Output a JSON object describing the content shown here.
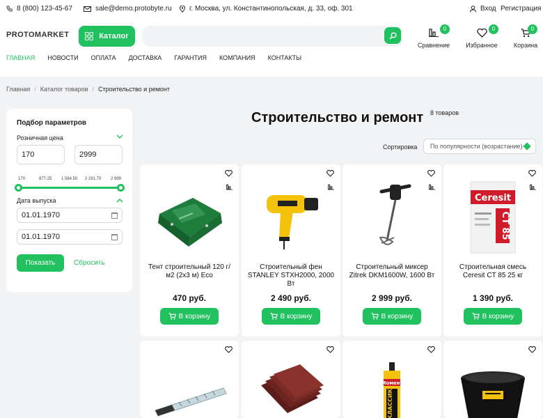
{
  "topbar": {
    "phone": "8 (800) 123-45-67",
    "email": "sale@demo.protobyte.ru",
    "address": "г. Москва, ул. Константинопольская, д. 33, оф. 301",
    "login": "Вход",
    "register": "Регистрация"
  },
  "header": {
    "logo": "PROTOMARKET",
    "catalog_label": "Каталог",
    "search_placeholder": "",
    "compare": {
      "label": "Сравнение",
      "count": "0"
    },
    "favorites": {
      "label": "Избранное",
      "count": "0"
    },
    "cart": {
      "label": "Корзина",
      "count": "0"
    }
  },
  "nav": [
    "ГЛАВНАЯ",
    "НОВОСТИ",
    "ОПЛАТА",
    "ДОСТАВКА",
    "ГАРАНТИЯ",
    "КОМПАНИЯ",
    "КОНТАКТЫ"
  ],
  "breadcrumbs": [
    "Главная",
    "Каталог товаров",
    "Строительство и ремонт"
  ],
  "filter": {
    "title": "Подбор параметров",
    "price_label": "Розничная цена",
    "price_min": "170",
    "price_max": "2999",
    "ticks": [
      "170",
      "877.25",
      "1 584.50",
      "2 291.75",
      "2 999"
    ],
    "date_label": "Дата выпуска",
    "date_from": "01.01.1970",
    "date_to": "01.01.1970",
    "show_label": "Показать",
    "reset_label": "Сбросить"
  },
  "page": {
    "title": "Строительство и ремонт",
    "count": "8 товаров",
    "sort_label": "Сортировка",
    "sort_value": "По популярности (возрастание)"
  },
  "products": [
    {
      "name": "Тент строительный 120 г/м2 (2х3 м) Eco",
      "price": "470 руб.",
      "buy": "В корзину",
      "image": "green-tarp"
    },
    {
      "name": "Строительный фен STANLEY STXH2000, 2000 Вт",
      "price": "2 490 руб.",
      "buy": "В корзину",
      "image": "heat-gun"
    },
    {
      "name": "Строительный миксер Zitrek DKM1600W, 1600 Вт",
      "price": "2 999 руб.",
      "buy": "В корзину",
      "image": "mixer"
    },
    {
      "name": "Строительная смесь Ceresit CT 85 25 кг",
      "price": "1 390 руб.",
      "buy": "В корзину",
      "image": "ceresit-bag",
      "brand": "Ceresit",
      "code": "CT 85"
    },
    {
      "name": "",
      "price": "",
      "buy": "",
      "image": "ruler"
    },
    {
      "name": "",
      "price": "",
      "buy": "",
      "image": "sanding-sheets"
    },
    {
      "name": "",
      "price": "",
      "buy": "",
      "image": "glue-tube",
      "brand": "Момент",
      "code": "КЛАССИК"
    },
    {
      "name": "",
      "price": "",
      "buy": "",
      "image": "black-tub"
    }
  ],
  "colors": {
    "accent": "#21c15f",
    "background": "#f2f3f5"
  }
}
